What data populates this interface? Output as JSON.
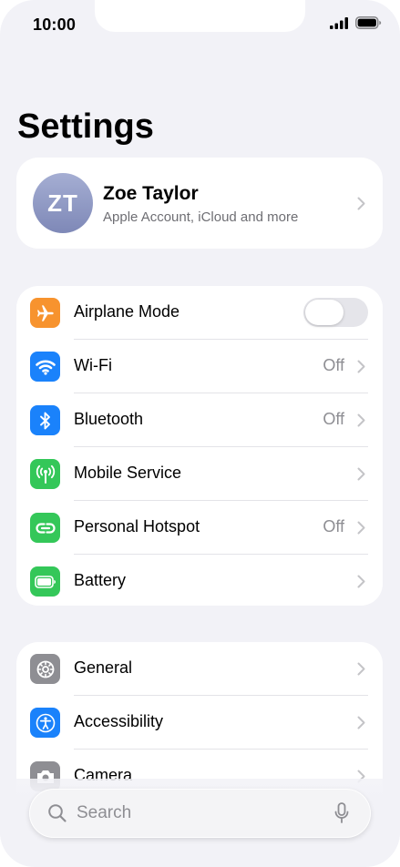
{
  "status_bar": {
    "time": "10:00"
  },
  "page": {
    "title": "Settings"
  },
  "profile": {
    "initials": "ZT",
    "name": "Zoe Taylor",
    "subtitle": "Apple Account, iCloud and more"
  },
  "connectivity": [
    {
      "label": "Airplane Mode",
      "icon": "airplane-icon",
      "color": "#f7932e",
      "control": "toggle",
      "state": "off"
    },
    {
      "label": "Wi-Fi",
      "icon": "wifi-icon",
      "color": "#1a82fb",
      "value": "Off"
    },
    {
      "label": "Bluetooth",
      "icon": "bluetooth-icon",
      "color": "#1a82fb",
      "value": "Off"
    },
    {
      "label": "Mobile Service",
      "icon": "antenna-icon",
      "color": "#34c759",
      "value": ""
    },
    {
      "label": "Personal Hotspot",
      "icon": "hotspot-icon",
      "color": "#34c759",
      "value": "Off"
    },
    {
      "label": "Battery",
      "icon": "battery-icon",
      "color": "#34c759",
      "value": ""
    }
  ],
  "system": [
    {
      "label": "General",
      "icon": "gear-icon",
      "color": "#8e8e93"
    },
    {
      "label": "Accessibility",
      "icon": "accessibility-icon",
      "color": "#1a82fb"
    },
    {
      "label": "Camera",
      "icon": "camera-icon",
      "color": "#8e8e93"
    }
  ],
  "search": {
    "placeholder": "Search"
  }
}
